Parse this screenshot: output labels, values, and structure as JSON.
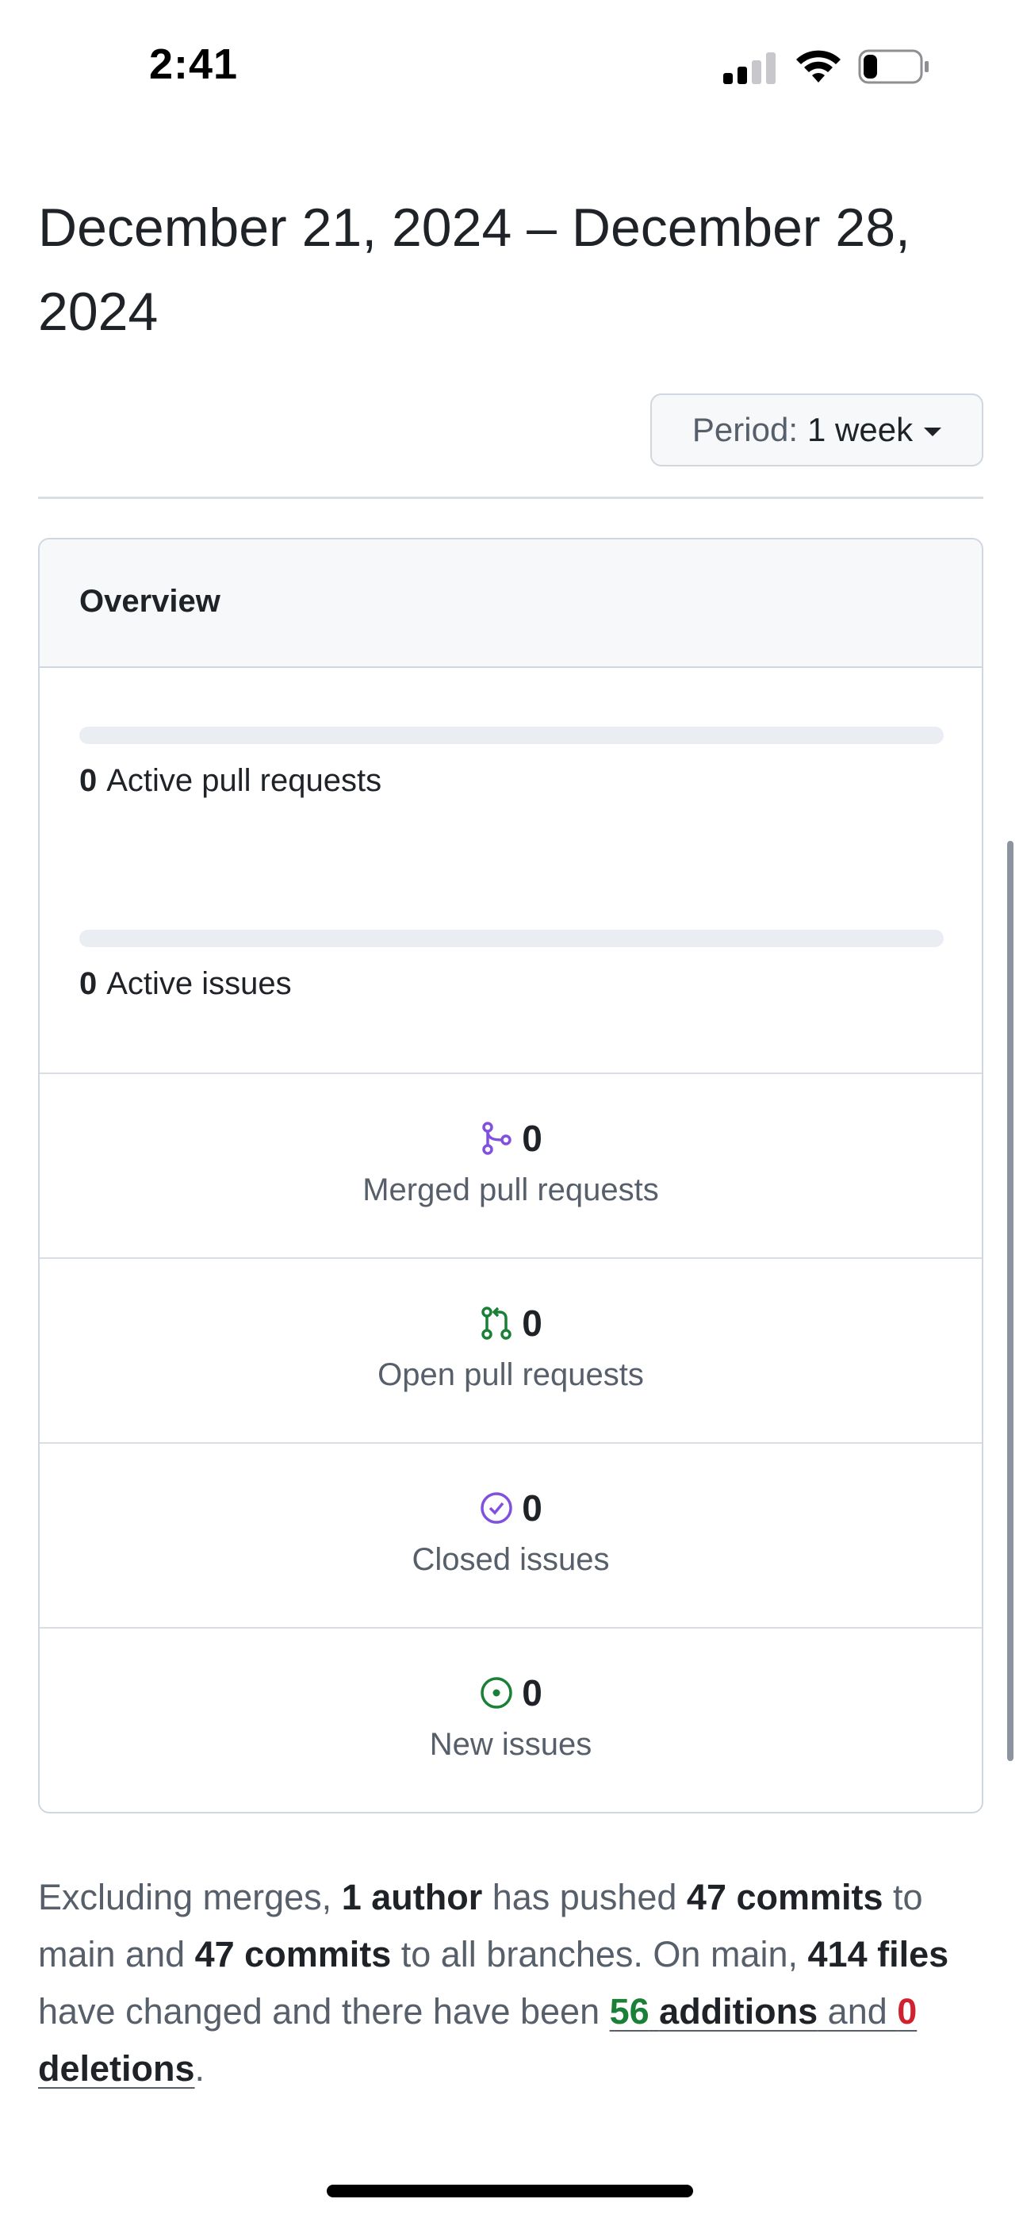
{
  "status_bar": {
    "time": "2:41",
    "signal_bars_filled": 2,
    "signal_bars_total": 4,
    "battery_level": 0.25
  },
  "heading": {
    "date_range": "December 21, 2024 – December 28, 2024"
  },
  "period": {
    "label": "Period:",
    "value": "1 week"
  },
  "overview": {
    "title": "Overview",
    "active_pull_requests": {
      "count": "0",
      "label": "Active pull requests",
      "progress": 0
    },
    "active_issues": {
      "count": "0",
      "label": "Active issues",
      "progress": 0
    },
    "stats": [
      {
        "value": "0",
        "label": "Merged pull requests",
        "icon": "git-merge-icon",
        "color": "#8250df"
      },
      {
        "value": "0",
        "label": "Open pull requests",
        "icon": "git-pull-request-icon",
        "color": "#1a7f37"
      },
      {
        "value": "0",
        "label": "Closed issues",
        "icon": "issue-closed-icon",
        "color": "#8250df"
      },
      {
        "value": "0",
        "label": "New issues",
        "icon": "issue-opened-icon",
        "color": "#1a7f37"
      }
    ]
  },
  "summary": {
    "t1": "Excluding merges, ",
    "authors": "1 author",
    "t2": " has pushed ",
    "commits_main": "47 commits",
    "t3": " to main and ",
    "commits_all": "47 commits",
    "t4": " to all branches. On main, ",
    "files": "414 files",
    "t5": " have changed and there have been ",
    "additions_num": "56",
    "additions_word": "additions",
    "t6": " and ",
    "deletions_num": "0",
    "deletions_word": "deletions",
    "t7": "."
  },
  "colors": {
    "accent_green": "#1a7f37",
    "accent_purple": "#8250df",
    "accent_red": "#cf222e",
    "muted_text": "#57606a"
  }
}
